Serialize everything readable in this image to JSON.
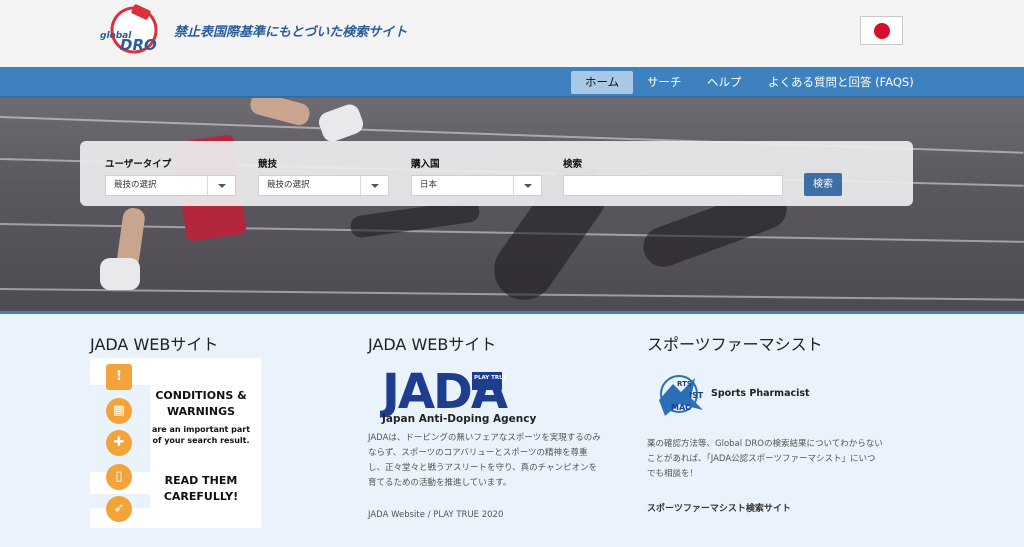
{
  "header": {
    "logo_top": "global",
    "logo_main": "DRO",
    "site_title": "禁止表国際基準にもとづいた検索サイト",
    "flag_icon": "japan-flag-icon"
  },
  "nav": {
    "items": [
      "ホーム",
      "サーチ",
      "ヘルプ",
      "よくある質問と回答 (FAQS)"
    ],
    "active_index": 0
  },
  "search": {
    "user_type_label": "ユーザータイプ",
    "user_type_value": "競技の選択",
    "sport_label": "競技",
    "sport_value": "競技の選択",
    "country_label": "購入国",
    "country_value": "日本",
    "keyword_label": "検索",
    "keyword_value": "",
    "submit_label": "検索"
  },
  "columns": {
    "left": {
      "heading": "JADA WEBサイト",
      "banner_line1": "CONDITIONS &",
      "banner_line2": "WARNINGS",
      "banner_line3": "are an important part",
      "banner_line4": "of your search result.",
      "banner_line5": "READ THEM",
      "banner_line6": "CAREFULLY!"
    },
    "middle": {
      "heading": "JADA WEBサイト",
      "logo_text": "JADA",
      "logo_badge": "PLAY TRUE",
      "logo_caption": "Japan Anti-Doping Agency",
      "description": [
        "JADAは、ドーピングの無いフェアなスポーツを実現するのみ",
        "ならず、スポーツのコアバリューとスポーツの精神を尊重",
        "し、正々堂々と戦うアスリートを守り、真のチャンピオンを",
        "育てるための活動を推進しています。"
      ],
      "footer": "JADA Website / PLAY TRUE 2020"
    },
    "right": {
      "heading": "スポーツファーマシスト",
      "logo_text": "Sports Pharmacist",
      "description": [
        "薬の確認方法等、Global DROの検索結果についてわからない",
        "ことがあれば、「JADA公認スポーツファーマシスト」にいつ",
        "でも相談を！"
      ],
      "link": "スポーツファーマシスト検索サイト"
    }
  },
  "colors": {
    "nav_bg": "#3d82bf",
    "nav_active": "#a9c8e6",
    "title": "#2a5d9a",
    "warning_orange": "#f2a33a",
    "jada_blue": "#1f3d8f",
    "page_bg": "#eaf3fb"
  }
}
